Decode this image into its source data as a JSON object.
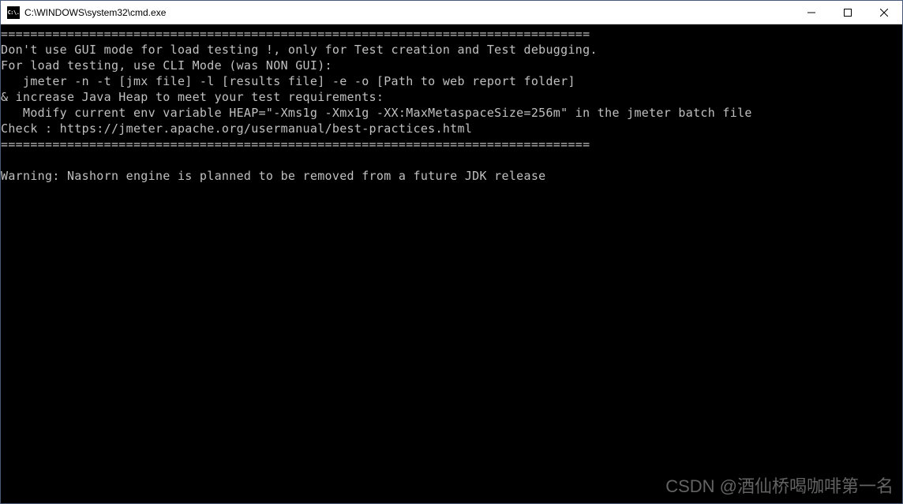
{
  "window": {
    "title": "C:\\WINDOWS\\system32\\cmd.exe",
    "icon_label": "C:\\."
  },
  "terminal": {
    "lines": [
      "================================================================================",
      "Don't use GUI mode for load testing !, only for Test creation and Test debugging.",
      "For load testing, use CLI Mode (was NON GUI):",
      "   jmeter -n -t [jmx file] -l [results file] -e -o [Path to web report folder]",
      "& increase Java Heap to meet your test requirements:",
      "   Modify current env variable HEAP=\"-Xms1g -Xmx1g -XX:MaxMetaspaceSize=256m\" in the jmeter batch file",
      "Check : https://jmeter.apache.org/usermanual/best-practices.html",
      "================================================================================",
      "",
      "Warning: Nashorn engine is planned to be removed from a future JDK release"
    ]
  },
  "watermark": "CSDN @酒仙桥喝咖啡第一名"
}
